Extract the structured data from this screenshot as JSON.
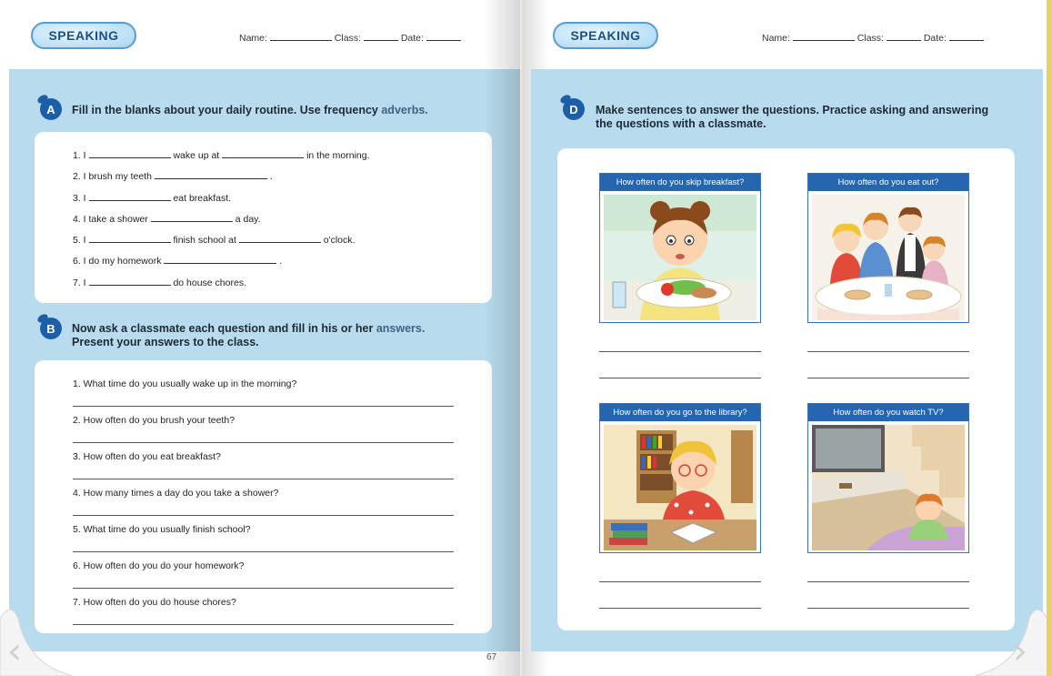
{
  "left": {
    "header": {
      "section_label": "SPEAKING",
      "name_label": "Name:",
      "class_label": "Class:",
      "date_label": "Date:"
    },
    "section_a": {
      "badge": "A",
      "instruction_main": "Fill in the blanks about your daily routine. Use frequency",
      "instruction_accent": "adverbs.",
      "items": [
        {
          "p1": "1. I",
          "p2": "wake up at",
          "p3": "in the morning."
        },
        {
          "p1": "2. I brush my teeth",
          "p2": "."
        },
        {
          "p1": "3. I",
          "p2": "eat breakfast."
        },
        {
          "p1": "4. I take a shower",
          "p2": "a day."
        },
        {
          "p1": "5. I",
          "p2": "finish school at",
          "p3": "o'clock."
        },
        {
          "p1": "6. I do my homework",
          "p2": "."
        },
        {
          "p1": "7. I",
          "p2": "do house chores."
        }
      ]
    },
    "section_b": {
      "badge": "B",
      "instruction_line1_main": "Now ask a classmate each question and fill in his or her",
      "instruction_line1_accent": "answers.",
      "instruction_line2": "Present your answers to the class.",
      "questions": [
        "1. What time do you usually wake up in the morning?",
        "2. How often do you brush your teeth?",
        "3. How often do you eat breakfast?",
        "4. How many times a day do you take a shower?",
        "5. What time do you usually finish school?",
        "6. How often do you do your homework?",
        "7. How often do you do house chores?"
      ]
    },
    "page_number": "67"
  },
  "right": {
    "header": {
      "section_label": "SPEAKING",
      "name_label": "Name:",
      "class_label": "Class:",
      "date_label": "Date:"
    },
    "section_d": {
      "badge": "D",
      "instruction_line1": "Make sentences to answer the questions. Practice asking and answering",
      "instruction_line2": "the questions with a classmate.",
      "pictures": [
        {
          "caption": "How often do you skip breakfast?",
          "icon": "girl-eating-breakfast-illustration"
        },
        {
          "caption": "How often do you eat out?",
          "icon": "family-restaurant-illustration"
        },
        {
          "caption": "How often do you go to the library?",
          "icon": "girl-reading-library-illustration"
        },
        {
          "caption": "How often do you watch TV?",
          "icon": "boy-watching-tv-illustration"
        }
      ]
    }
  },
  "navigation": {
    "prev_icon": "prev-page-arrow-icon",
    "next_icon": "next-page-arrow-icon"
  },
  "colors": {
    "page_blue": "#b8dcee",
    "badge_blue": "#1c5fa8",
    "caption_blue": "#2466b0",
    "accent_text": "#3f6282"
  }
}
